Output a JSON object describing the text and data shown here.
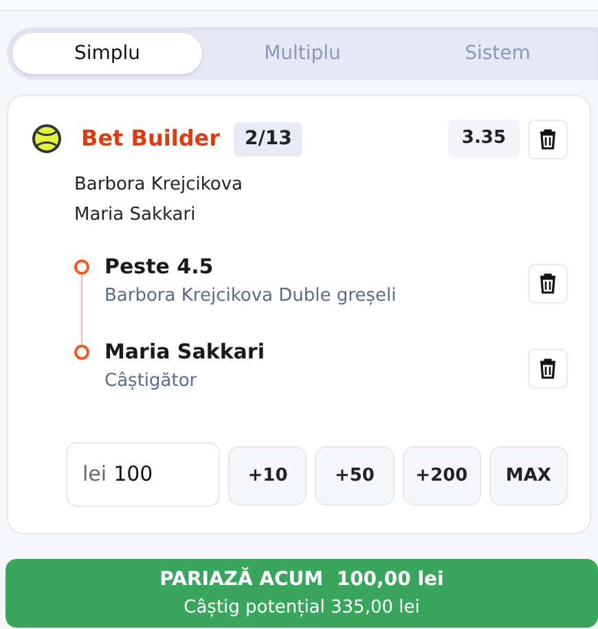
{
  "tabs": [
    {
      "label": "Simplu",
      "selected": true
    },
    {
      "label": "Multiplu",
      "selected": false
    },
    {
      "label": "Sistem",
      "selected": false
    }
  ],
  "bet": {
    "title": "Bet Builder",
    "count": "2/13",
    "odds": "3.35",
    "participants": [
      "Barbora Krejcikova",
      "Maria Sakkari"
    ],
    "selections": [
      {
        "market": "Peste 4.5",
        "detail": "Barbora Krejcikova Duble greșeli"
      },
      {
        "market": "Maria Sakkari",
        "detail": "Câștigător"
      }
    ]
  },
  "stake": {
    "currency": "lei",
    "value": "100",
    "quick": [
      "+10",
      "+50",
      "+200",
      "MAX"
    ]
  },
  "submit": {
    "label": "PARIAZĂ ACUM  100,00 lei",
    "potential": "Câștig potențial 335,00 lei"
  }
}
